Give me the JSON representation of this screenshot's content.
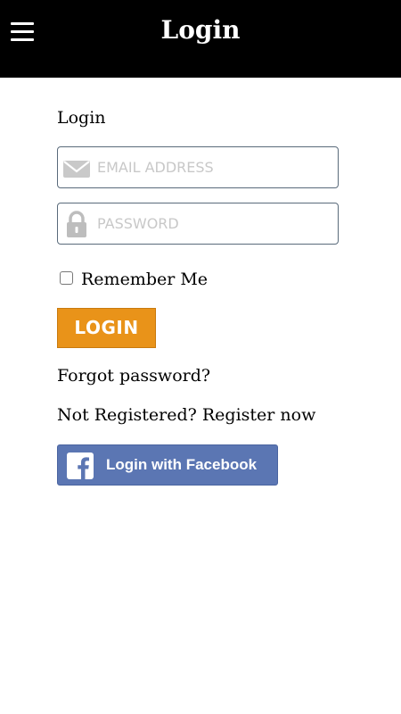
{
  "header": {
    "title": "Login",
    "menu_icon": "hamburger-menu-icon",
    "background": "#000000"
  },
  "form": {
    "heading": "Login",
    "email": {
      "placeholder": "EMAIL ADDRESS",
      "value": "",
      "icon": "envelope-icon"
    },
    "password": {
      "placeholder": "PASSWORD",
      "value": "",
      "icon": "lock-icon"
    },
    "remember_me": {
      "label": "Remember Me",
      "checked": false
    },
    "login_button": {
      "label": "LOGIN",
      "color": "#E99319"
    },
    "forgot_password": "Forgot password?",
    "register_prompt": "Not Registered? Register now",
    "facebook_button": {
      "label": "Login with Facebook",
      "icon": "facebook-icon",
      "color": "#5B76B3"
    }
  }
}
